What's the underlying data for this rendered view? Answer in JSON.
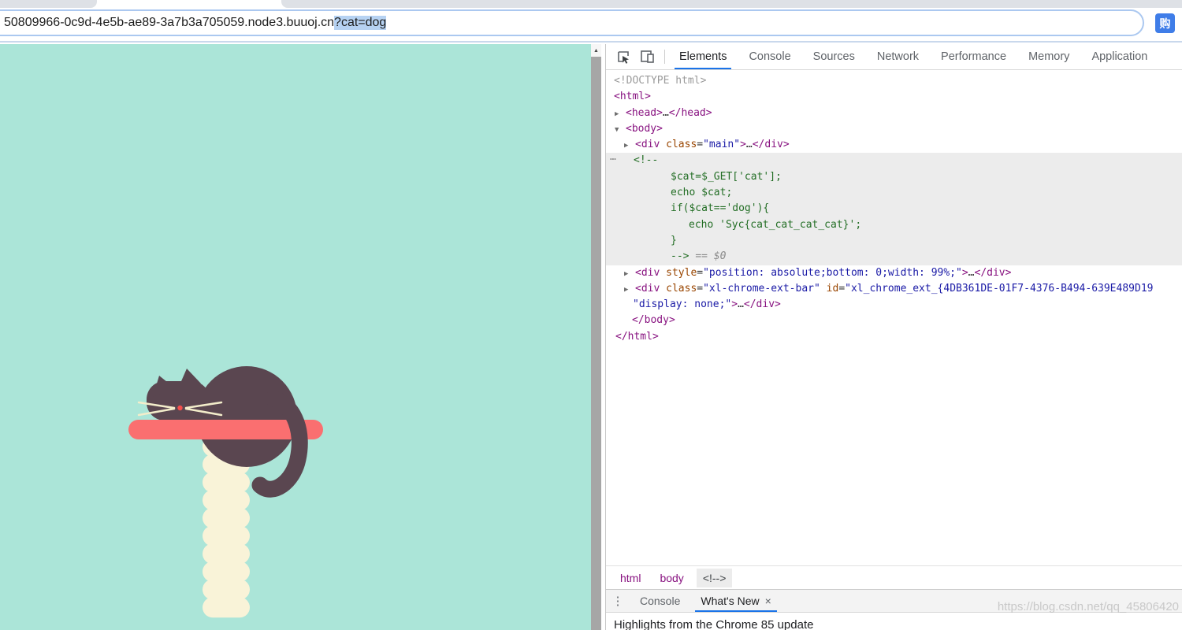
{
  "colors": {
    "page_bg": "#abe5d8",
    "cat": "#5a4650",
    "shelf": "#fa6f70",
    "post": "#f9f3d8",
    "whiskers": "#f3edcb",
    "nose": "#f4504c",
    "accent": "#1a73e8",
    "tag": "#881280",
    "attr": "#994500",
    "val": "#1a1aa6",
    "comment": "#236e25",
    "gray": "#9a9a9a",
    "hl": "#ececec",
    "url_selection": "#b6d2f2",
    "tabstrip": "#dee1e6",
    "urlbar_border": "#abc8f0",
    "ext_blue": "#3f7de8"
  },
  "icons": {
    "scroll_up": "▲",
    "menu_vertical": "⋮",
    "close": "×",
    "arrow_right": "▶",
    "arrow_down": "▼",
    "gutter_dots": "…"
  },
  "browser": {
    "url_host": "50809966-0c9d-4e5b-ae89-3a7b3a705059.node3.buuoj.cn",
    "url_query_selected": "?cat=dog",
    "extension_badge": "购"
  },
  "devtools": {
    "toolbar": {
      "tabs": [
        "Elements",
        "Console",
        "Sources",
        "Network",
        "Performance",
        "Memory",
        "Application"
      ],
      "active_tab": "Elements"
    },
    "tree": {
      "lines": [
        {
          "pad": 10,
          "arrow": null,
          "hl": false,
          "gutter": false,
          "segs": [
            [
              "gray",
              "<!DOCTYPE html>"
            ]
          ]
        },
        {
          "pad": 10,
          "arrow": null,
          "hl": false,
          "gutter": false,
          "segs": [
            [
              "tag",
              "<html>"
            ]
          ]
        },
        {
          "pad": 25,
          "arrow": "right",
          "hl": false,
          "gutter": false,
          "segs": [
            [
              "tag",
              "<head>"
            ],
            [
              "txt",
              "…"
            ],
            [
              "tag",
              "</head>"
            ]
          ]
        },
        {
          "pad": 25,
          "arrow": "down",
          "hl": false,
          "gutter": false,
          "segs": [
            [
              "tag",
              "<body>"
            ]
          ]
        },
        {
          "pad": 37,
          "arrow": "right",
          "hl": false,
          "gutter": false,
          "segs": [
            [
              "tag",
              "<div"
            ],
            [
              "txt",
              " "
            ],
            [
              "attr",
              "class"
            ],
            [
              "txt",
              "="
            ],
            [
              "val",
              "\"main\""
            ],
            [
              "tag",
              ">"
            ],
            [
              "txt",
              "…"
            ],
            [
              "tag",
              "</div>"
            ]
          ]
        },
        {
          "pad": 35,
          "arrow": null,
          "hl": true,
          "gutter": true,
          "segs": [
            [
              "com",
              "<!--"
            ]
          ]
        },
        {
          "pad": 82,
          "arrow": null,
          "hl": true,
          "gutter": false,
          "segs": [
            [
              "com",
              "$cat=$_GET['cat'];"
            ]
          ]
        },
        {
          "pad": 82,
          "arrow": null,
          "hl": true,
          "gutter": false,
          "segs": [
            [
              "com",
              "echo $cat;"
            ]
          ]
        },
        {
          "pad": 82,
          "arrow": null,
          "hl": true,
          "gutter": false,
          "segs": [
            [
              "com",
              "if($cat=='dog'){"
            ]
          ]
        },
        {
          "pad": 105,
          "arrow": null,
          "hl": true,
          "gutter": false,
          "segs": [
            [
              "com",
              "echo 'Syc{cat_cat_cat_cat}';"
            ]
          ]
        },
        {
          "pad": 82,
          "arrow": null,
          "hl": true,
          "gutter": false,
          "segs": [
            [
              "com",
              "}"
            ]
          ]
        },
        {
          "pad": 82,
          "arrow": null,
          "hl": true,
          "gutter": false,
          "segs": [
            [
              "com",
              "--> "
            ],
            [
              "dim",
              "== $0"
            ]
          ]
        },
        {
          "pad": 37,
          "arrow": "right",
          "hl": false,
          "gutter": false,
          "segs": [
            [
              "tag",
              "<div"
            ],
            [
              "txt",
              " "
            ],
            [
              "attr",
              "style"
            ],
            [
              "txt",
              "="
            ],
            [
              "val",
              "\"position: absolute;bottom: 0;width: 99%;\""
            ],
            [
              "tag",
              ">"
            ],
            [
              "txt",
              "…"
            ],
            [
              "tag",
              "</div>"
            ]
          ]
        },
        {
          "pad": 37,
          "arrow": "right",
          "hl": false,
          "gutter": false,
          "segs": [
            [
              "tag",
              "<div"
            ],
            [
              "txt",
              " "
            ],
            [
              "attr",
              "class"
            ],
            [
              "txt",
              "="
            ],
            [
              "val",
              "\"xl-chrome-ext-bar\""
            ],
            [
              "txt",
              " "
            ],
            [
              "attr",
              "id"
            ],
            [
              "txt",
              "="
            ],
            [
              "val",
              "\"xl_chrome_ext_{4DB361DE-01F7-4376-B494-639E489D19"
            ]
          ]
        },
        {
          "pad": 34,
          "arrow": null,
          "hl": false,
          "gutter": false,
          "segs": [
            [
              "val",
              "\"display: none;\""
            ],
            [
              "tag",
              ">"
            ],
            [
              "txt",
              "…"
            ],
            [
              "tag",
              "</div>"
            ]
          ]
        },
        {
          "pad": 33,
          "arrow": null,
          "hl": false,
          "gutter": false,
          "segs": [
            [
              "tag",
              "</body>"
            ]
          ]
        },
        {
          "pad": 12,
          "arrow": null,
          "hl": false,
          "gutter": false,
          "segs": [
            [
              "tag",
              "</html>"
            ]
          ]
        }
      ]
    },
    "breadcrumb": [
      {
        "label": "html",
        "selected": false
      },
      {
        "label": "body",
        "selected": false
      },
      {
        "label": "<!-->",
        "selected": true
      }
    ],
    "drawer": {
      "tabs": [
        {
          "label": "Console",
          "active": false,
          "closable": false
        },
        {
          "label": "What's New",
          "active": true,
          "closable": true
        }
      ],
      "content_text": "Highlights from the Chrome 85 update"
    }
  },
  "watermark": "https://blog.csdn.net/qq_45806420"
}
